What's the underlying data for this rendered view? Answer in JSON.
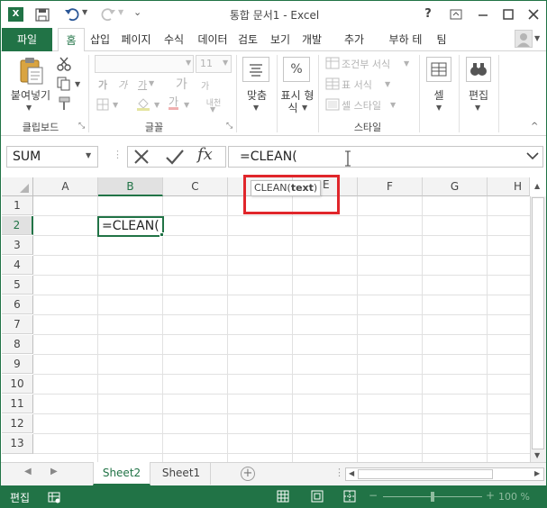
{
  "app": {
    "title": "통합 문서1 - Excel",
    "window_buttons": {
      "help": "?"
    },
    "accent": "#217346"
  },
  "ribbon_tabs": [
    "파일",
    "홈",
    "삽입",
    "페이지",
    "수식",
    "데이터",
    "검토",
    "보기",
    "개발",
    "추가",
    "부하 테",
    "팀"
  ],
  "ribbon": {
    "clipboard": {
      "paste_label": "붙여넣기",
      "group_label": "클립보드"
    },
    "font": {
      "size_value": "11",
      "bold": "가",
      "italic": "가",
      "underline": "가",
      "grow": "가",
      "shrink": "가",
      "phonetic": "내천",
      "color_a": "가",
      "group_label": "글꼴"
    },
    "alignment": {
      "label": "맞춤"
    },
    "number": {
      "symbol": "%",
      "label_line1": "표시 형",
      "label_line2": "식"
    },
    "styles": {
      "conditional": "조건부 서식",
      "table": "표 서식",
      "cell_styles": "셀 스타일",
      "group_label": "스타일"
    },
    "cells": {
      "label": "셀"
    },
    "editing": {
      "label": "편집"
    }
  },
  "formula_bar": {
    "name_box": "SUM",
    "fx": "fx",
    "formula": "=CLEAN("
  },
  "grid": {
    "columns": [
      "A",
      "B",
      "C",
      "D",
      "E",
      "F",
      "G",
      "H"
    ],
    "rows": [
      "1",
      "2",
      "3",
      "4",
      "5",
      "6",
      "7",
      "8",
      "9",
      "10",
      "11",
      "12",
      "13"
    ],
    "active_cell_value": "=CLEAN(",
    "tooltip": {
      "func": "CLEAN(",
      "arg": "text",
      "close": ")"
    },
    "partial_header_e": "E"
  },
  "sheets": [
    "Sheet2",
    "Sheet1"
  ],
  "status": {
    "mode": "편집",
    "zoom": "100 %"
  }
}
